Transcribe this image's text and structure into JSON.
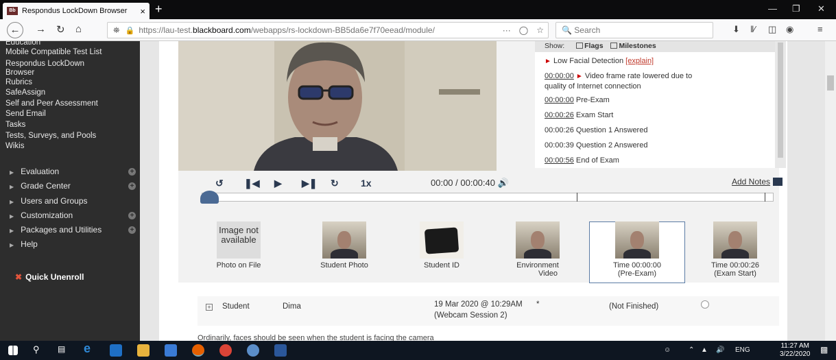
{
  "browser": {
    "tab_title": "Respondus LockDown Browser",
    "tab_close": "×",
    "new_tab": "+",
    "url_prefix": "https://lau-test.",
    "url_domain": "blackboard.com",
    "url_path": "/webapps/rs-lockdown-BB5da6e7f70eead/module/",
    "url_more": "···",
    "search_placeholder": "Search",
    "window_controls": [
      "—",
      "❐",
      "✕"
    ]
  },
  "sidebar": {
    "cut_top_item": "Education",
    "tools_links": [
      "Mobile Compatible Test List",
      "Respondus LockDown",
      "Browser",
      "Rubrics",
      "SafeAssign",
      "Self and Peer Assessment",
      "Send Email",
      "Tasks",
      "Tests, Surveys, and Pools",
      "Wikis"
    ],
    "sections": [
      {
        "label": "Evaluation",
        "has_plus": true
      },
      {
        "label": "Grade Center",
        "has_plus": true
      },
      {
        "label": "Users and Groups",
        "has_plus": false
      },
      {
        "label": "Customization",
        "has_plus": true
      },
      {
        "label": "Packages and Utilities",
        "has_plus": true
      },
      {
        "label": "Help",
        "has_plus": false
      }
    ],
    "quick_unenroll": "Quick Unenroll"
  },
  "flags_panel": {
    "show_label": "Show:",
    "flags_label": "Flags",
    "milestones_label": "Milestones",
    "low_facial": "Low Facial Detection",
    "explain": "[explain]",
    "events": [
      {
        "time": "00:00:00",
        "flag": true,
        "text": "Video frame rate lowered due to",
        "text2": "quality of Internet connection"
      },
      {
        "time": "00:00:00",
        "flag": false,
        "text": "Pre-Exam"
      },
      {
        "time": "00:00:26",
        "flag": false,
        "text": "Exam Start"
      },
      {
        "time": "00:00:26",
        "flag": false,
        "text": "Question 1 Answered"
      },
      {
        "time": "00:00:39",
        "flag": false,
        "text": "Question 2 Answered"
      },
      {
        "time": "00:00:56",
        "flag": false,
        "text": "End of Exam"
      }
    ]
  },
  "player": {
    "speed": "1x",
    "timecode": "00:00 / 00:00:40",
    "add_notes": "Add Notes"
  },
  "thumbnails": [
    {
      "label": "Photo on File",
      "label2": "",
      "no_image_text": "Image not available"
    },
    {
      "label": "Student Photo",
      "label2": ""
    },
    {
      "label": "Student ID",
      "label2": ""
    },
    {
      "label": "Environment",
      "label2": "Video"
    },
    {
      "label": "Time 00:00:00",
      "label2": "(Pre-Exam)"
    },
    {
      "label": "Time 00:00:26",
      "label2": "(Exam Start)"
    }
  ],
  "student_row": {
    "role": "Student",
    "name": "Dima",
    "date": "19 Mar 2020 @ 10:29AM",
    "session": "(Webcam Session 2)",
    "asterisk": "*",
    "status": "(Not Finished)"
  },
  "bottom_text": "Ordinarily, faces should be seen when the student is facing the camera",
  "taskbar": {
    "tray_lang": "ENG",
    "time": "11:27 AM",
    "date": "3/22/2020"
  }
}
